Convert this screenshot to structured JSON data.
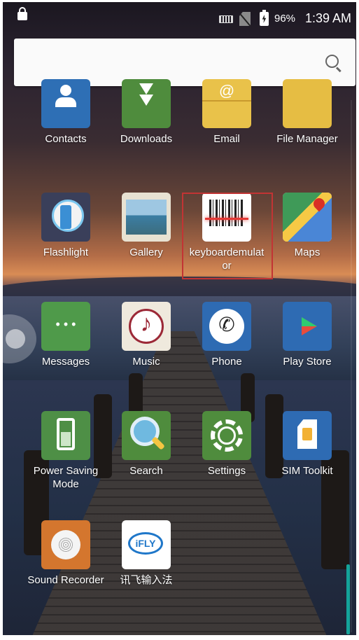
{
  "status_bar": {
    "battery_percent": "96%",
    "time": "1:39 AM",
    "icons": [
      "lock-icon",
      "keyboard-icon",
      "no-sim-icon",
      "battery-charging-icon"
    ]
  },
  "search": {
    "placeholder": "",
    "icon": "search-icon"
  },
  "apps": [
    {
      "label": "Contacts",
      "icon": "contacts-icon"
    },
    {
      "label": "Downloads",
      "icon": "downloads-icon"
    },
    {
      "label": "Email",
      "icon": "email-icon"
    },
    {
      "label": "File Manager",
      "icon": "file-manager-icon"
    },
    {
      "label": "Flashlight",
      "icon": "flashlight-icon"
    },
    {
      "label": "Gallery",
      "icon": "gallery-icon"
    },
    {
      "label": "keyboardemulat\nor",
      "icon": "barcode-icon",
      "highlighted": true
    },
    {
      "label": "Maps",
      "icon": "maps-icon"
    },
    {
      "label": "Messages",
      "icon": "messages-icon"
    },
    {
      "label": "Music",
      "icon": "music-icon"
    },
    {
      "label": "Phone",
      "icon": "phone-icon"
    },
    {
      "label": "Play Store",
      "icon": "play-store-icon"
    },
    {
      "label": "Power Saving\nMode",
      "icon": "power-saving-icon"
    },
    {
      "label": "Search",
      "icon": "magnifier-icon"
    },
    {
      "label": "Settings",
      "icon": "settings-gear-icon"
    },
    {
      "label": "SIM Toolkit",
      "icon": "sim-card-icon"
    },
    {
      "label": "Sound Recorder",
      "icon": "sound-recorder-icon"
    },
    {
      "label": "讯飞输入法",
      "icon": "ifly-icon"
    }
  ],
  "colors": {
    "highlight_border": "#c23434",
    "scroll_indicator": "#14a39a",
    "search_bar": "#fafafa"
  }
}
